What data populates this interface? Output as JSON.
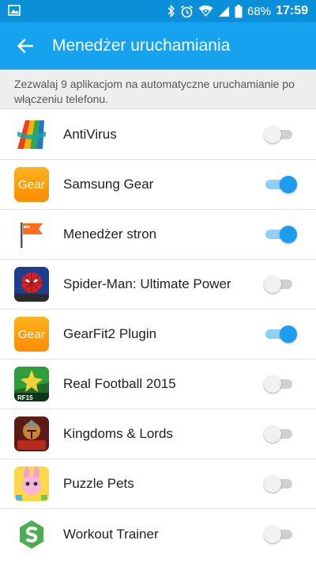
{
  "status_bar": {
    "battery_percent": "68%",
    "time": "17:59",
    "icons": [
      "image-icon",
      "bluetooth-icon",
      "alarm-icon",
      "wifi-icon",
      "signal-icon",
      "battery-icon"
    ]
  },
  "app_bar": {
    "title": "Menedżer uruchamiania",
    "back_icon": "arrow-left-icon"
  },
  "description": "Zezwalaj 9 aplikacjom na automatyczne uruchamianie po włączeniu telefonu.",
  "colors": {
    "app_bar": "#16a2ee",
    "status_bar": "#0a8fd8",
    "toggle_on": "#1b9df0",
    "toggle_off": "#d0d0d0"
  },
  "apps": [
    {
      "name": "AntiVirus",
      "icon": "avg-antivirus-icon",
      "enabled": false
    },
    {
      "name": "Samsung Gear",
      "icon": "gear-app-icon",
      "icon_text": "Gear",
      "enabled": true
    },
    {
      "name": "Menedżer stron",
      "icon": "flag-icon",
      "enabled": true
    },
    {
      "name": "Spider-Man: Ultimate Power",
      "icon": "spiderman-icon",
      "enabled": false
    },
    {
      "name": "GearFit2 Plugin",
      "icon": "gear-app-icon",
      "icon_text": "Gear",
      "enabled": true
    },
    {
      "name": "Real Football 2015",
      "icon": "football-icon",
      "icon_text": "RF15",
      "enabled": false
    },
    {
      "name": "Kingdoms & Lords",
      "icon": "kingdoms-icon",
      "enabled": false
    },
    {
      "name": "Puzzle Pets",
      "icon": "puzzle-pets-icon",
      "enabled": false
    },
    {
      "name": "Workout Trainer",
      "icon": "workout-trainer-icon",
      "enabled": false
    }
  ]
}
